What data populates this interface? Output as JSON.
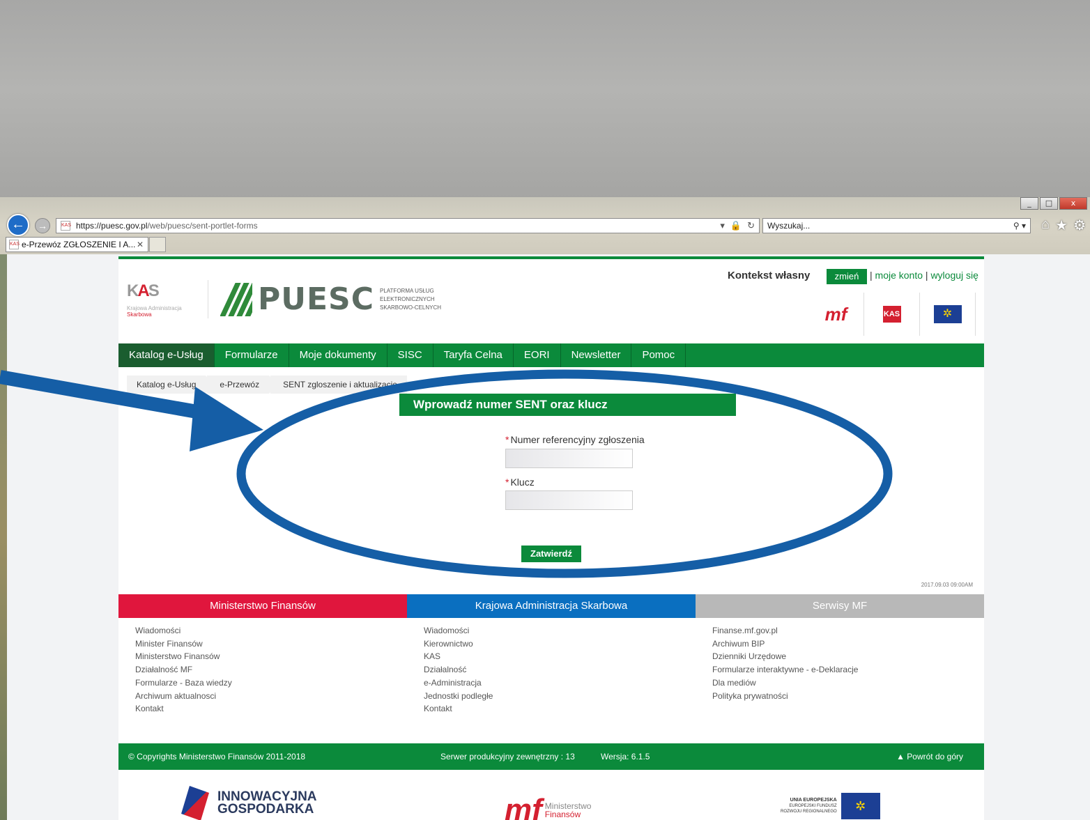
{
  "browser": {
    "url_domain": "https://puesc.gov.pl",
    "url_path": "/web/puesc/sent-portlet-forms",
    "search_placeholder": "Wyszukaj...",
    "tab_title": "e-Przewóz ZGŁOSZENIE I A...",
    "window_controls": [
      "_",
      "□",
      "x"
    ]
  },
  "header": {
    "kas_name_line1": "Krajowa Administracja",
    "kas_name_line2": "Skarbowa",
    "puesc_word": "PUESC",
    "puesc_sub": [
      "PLATFORMA USŁUG",
      "ELEKTRONICZNYCH",
      "SKARBOWO-CELNYCH"
    ],
    "context_label": "Kontekst własny",
    "change_button": "zmień",
    "my_account": "moje konto",
    "logout": "wyloguj się"
  },
  "nav": [
    "Katalog e-Usług",
    "Formularze",
    "Moje dokumenty",
    "SISC",
    "Taryfa Celna",
    "EORI",
    "Newsletter",
    "Pomoc"
  ],
  "breadcrumb": [
    "Katalog e-Usług",
    "e-Przewóz",
    "SENT zgloszenie i aktualizacje"
  ],
  "form": {
    "title": "Wprowadź numer SENT oraz klucz",
    "required_mark": "*",
    "reference_label": "Numer referencyjny zgłoszenia",
    "reference_value": "",
    "key_label": "Klucz",
    "key_value": "",
    "submit": "Zatwierdź"
  },
  "timestamp": "2017.09.03 09:00AM",
  "footer": {
    "columns": [
      {
        "title": "Ministerstwo Finansów",
        "color": "#e0163d",
        "links": [
          "Wiadomości",
          "Minister Finansów",
          "Ministerstwo Finansów",
          "Działalność MF",
          "Formularze - Baza wiedzy",
          "Archiwum aktualnosci",
          "Kontakt"
        ]
      },
      {
        "title": "Krajowa Administracja Skarbowa",
        "color": "#0a6fc0",
        "links": [
          "Wiadomości",
          "Kierownictwo",
          "KAS",
          "Działalność",
          "e-Administracja",
          "Jednostki podległe",
          "Kontakt"
        ]
      },
      {
        "title": "Serwisy MF",
        "color": "#b8b8b8",
        "links": [
          "Finanse.mf.gov.pl",
          "Archiwum BIP",
          "Dzienniki Urzędowe",
          "Formularze interaktywne - e-Deklaracje",
          "Dla mediów",
          "Polityka prywatności"
        ]
      }
    ],
    "copyright": "© Copyrights Ministerstwo Finansów 2011-2018",
    "server": "Serwer produkcyjny zewnętrzny : 13",
    "version": "Wersja: 6.1.5",
    "back_to_top": "▲ Powrót do góry",
    "logos": {
      "ig_line1": "INNOWACYJNA",
      "ig_line2": "GOSPODARKA",
      "mf_line1": "Ministerstwo",
      "mf_line2": "Finansów",
      "ue_line1": "UNIA EUROPEJSKA",
      "ue_line2": "EUROPEJSKI FUNDUSZ",
      "ue_line3": "ROZWOJU REGIONALNEGO"
    }
  },
  "colors": {
    "brand_green": "#0b8a3b",
    "annotation_blue": "#155ea6"
  }
}
